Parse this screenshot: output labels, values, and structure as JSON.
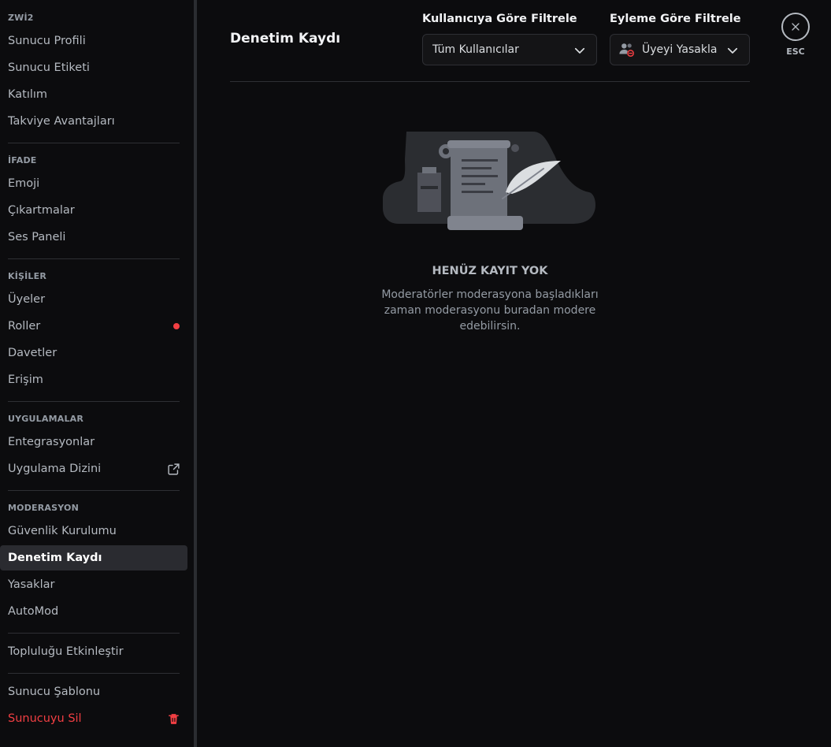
{
  "sidebar": {
    "sections": [
      {
        "header": "ZWİ2",
        "items": [
          "Sunucu Profili",
          "Sunucu Etiketi",
          "Katılım",
          "Takviye Avantajları"
        ]
      },
      {
        "header": "İFADE",
        "items": [
          "Emoji",
          "Çıkartmalar",
          "Ses Paneli"
        ]
      },
      {
        "header": "KİŞİLER",
        "items": [
          "Üyeler",
          "Roller",
          "Davetler",
          "Erişim"
        ]
      },
      {
        "header": "UYGULAMALAR",
        "items": [
          "Entegrasyonlar",
          "Uygulama Dizini"
        ]
      },
      {
        "header": "MODERASYON",
        "items": [
          "Güvenlik Kurulumu",
          "Denetim Kaydı",
          "Yasaklar",
          "AutoMod"
        ]
      }
    ],
    "extra": [
      "Topluluğu Etkinleştir",
      "Sunucu Şablonu",
      "Sunucuyu Sil"
    ],
    "active_item": "Denetim Kaydı"
  },
  "main": {
    "title": "Denetim Kaydı",
    "user_filter": {
      "label": "Kullanıcıya Göre Filtrele",
      "value": "Tüm Kullanıcılar"
    },
    "action_filter": {
      "label": "Eyleme Göre Filtrele",
      "value": "Üyeyi Yasakla"
    },
    "close": {
      "label": "ESC"
    },
    "empty": {
      "title": "HENÜZ KAYIT YOK",
      "line1": "Moderatörler moderasyona başladıkları",
      "line2": "zaman moderasyonu buradan modere",
      "line3": "edebilirsin."
    }
  },
  "colors": {
    "background": "#0c0c0e",
    "active": "#2a2b30",
    "danger": "#f23f43",
    "text": "#dbdee1",
    "muted": "#949ba4"
  },
  "icons": [
    "chevron-down-icon",
    "ban-member-icon",
    "close-icon",
    "external-link-icon",
    "trash-icon",
    "red-dot-badge"
  ]
}
